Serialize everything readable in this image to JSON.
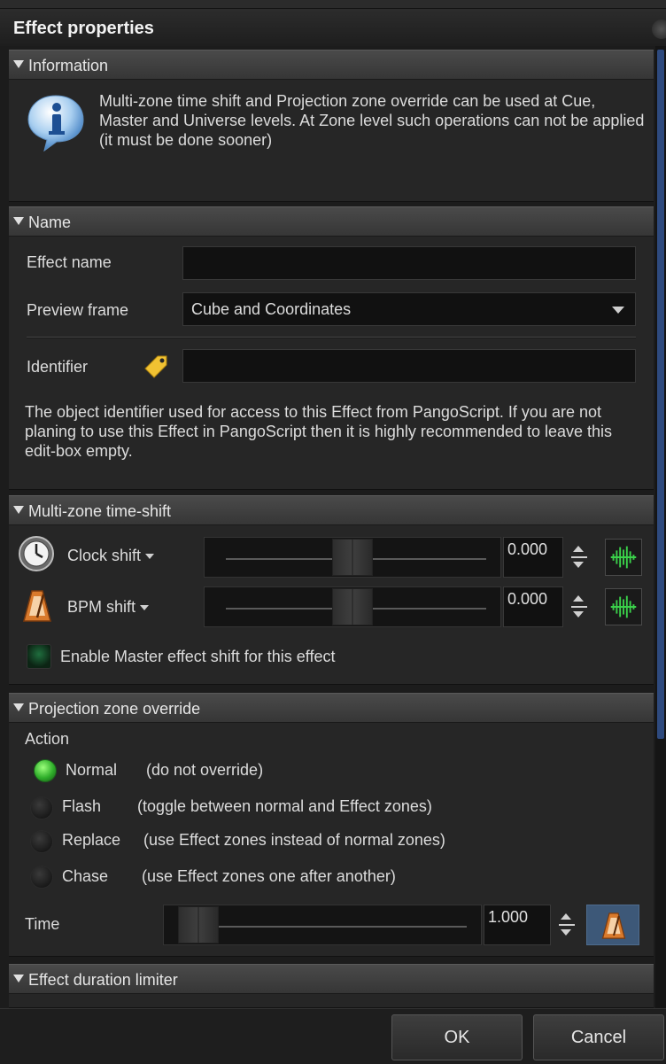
{
  "window": {
    "title": "Effect properties"
  },
  "colors": {
    "background": "#1c1c1c",
    "section_header": "#3f3f3f",
    "radio_on": "#3cc43c",
    "accent": "#2e4a7e"
  },
  "information": {
    "header": "Information",
    "icon": "info-icon",
    "text": "Multi-zone  time shift and Projection zone override can be used at Cue, Master and Universe levels. At  Zone level such operations can not be applied (it must be done sooner)"
  },
  "name_section": {
    "header": "Name",
    "effect_name_label": "Effect name",
    "effect_name_value": "",
    "preview_frame_label": "Preview frame",
    "preview_frame_value": "Cube and Coordinates",
    "identifier_label": "Identifier",
    "identifier_icon": "tag-icon",
    "identifier_value": "",
    "identifier_help": "The object identifier used for access to this Effect from PangoScript. If you are not planing to use this Effect in PangoScript then it is highly recommended to leave this edit-box empty."
  },
  "time_shift": {
    "header": "Multi-zone time-shift",
    "clock_label": "Clock shift",
    "clock_icon": "clock-icon",
    "clock_value": "0.000",
    "clock_position": 0.5,
    "bpm_label": "BPM shift",
    "bpm_icon": "metronome-icon",
    "bpm_value": "0.000",
    "bpm_position": 0.5,
    "wave_icon": "waveform-icon",
    "master_shift_label": "Enable Master effect shift for this effect",
    "master_shift_checked": true
  },
  "projection_override": {
    "header": "Projection zone  override",
    "action_label": "Action",
    "options": [
      {
        "label": "Normal",
        "desc": "(do not override)",
        "selected": true
      },
      {
        "label": "Flash",
        "desc": "(toggle between normal and Effect zones)",
        "selected": false
      },
      {
        "label": "Replace",
        "desc": "(use Effect zones instead of normal zones)",
        "selected": false
      },
      {
        "label": "Chase",
        "desc": "(use Effect zones one after another)",
        "selected": false
      }
    ],
    "time_label": "Time",
    "time_value": "1.000",
    "time_position": 0.05
  },
  "duration_limiter": {
    "header": "Effect duration limiter"
  },
  "buttons": {
    "ok": "OK",
    "cancel": "Cancel"
  }
}
